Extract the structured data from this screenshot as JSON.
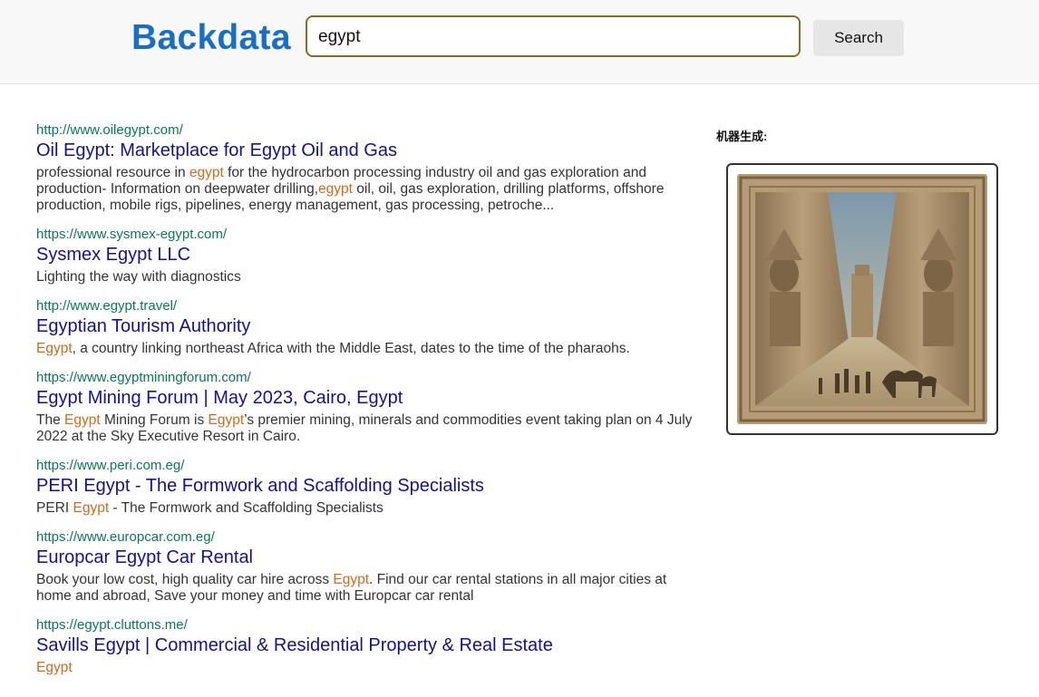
{
  "header": {
    "logo": "Backdata",
    "search_value": "egypt",
    "search_button_label": "Search",
    "brand_color": "#1a6fc4"
  },
  "side_panel": {
    "label": "机器生成:",
    "image_description_icon": "generated-egypt-image"
  },
  "results": [
    {
      "url": "http://www.oilegypt.com/",
      "title": "Oil Egypt: Marketplace for Egypt Oil and Gas",
      "snippet": [
        {
          "t": "professional resource in ",
          "h": false
        },
        {
          "t": "egypt",
          "h": true
        },
        {
          "t": " for the hydrocarbon processing industry oil and gas exploration and production- Information on deepwater drilling,",
          "h": false
        },
        {
          "t": "egypt",
          "h": true
        },
        {
          "t": " oil, oil, gas exploration, drilling platforms, offshore production, mobile rigs, pipelines, energy management, gas processing, petroche...",
          "h": false
        }
      ]
    },
    {
      "url": "https://www.sysmex-egypt.com/",
      "title": "Sysmex Egypt LLC",
      "snippet": [
        {
          "t": "Lighting the way with diagnostics",
          "h": false
        }
      ]
    },
    {
      "url": "http://www.egypt.travel/",
      "title": "Egyptian Tourism Authority",
      "snippet": [
        {
          "t": "Egypt",
          "h": true
        },
        {
          "t": ", a country linking northeast Africa with the Middle East, dates to the time of the pharaohs.",
          "h": false
        }
      ]
    },
    {
      "url": "https://www.egyptminingforum.com/",
      "title": "Egypt Mining Forum | May 2023, Cairo, Egypt",
      "snippet": [
        {
          "t": "The ",
          "h": false
        },
        {
          "t": "Egypt",
          "h": true
        },
        {
          "t": " Mining Forum is ",
          "h": false
        },
        {
          "t": "Egypt",
          "h": true
        },
        {
          "t": "’s premier mining, minerals and commodities event taking plan on 4 July 2022 at the Sky Executive Resort in Cairo.",
          "h": false
        }
      ]
    },
    {
      "url": "https://www.peri.com.eg/",
      "title": "PERI Egypt - The Formwork and Scaffolding Specialists",
      "snippet": [
        {
          "t": "PERI ",
          "h": false
        },
        {
          "t": "Egypt",
          "h": true
        },
        {
          "t": " - The Formwork and Scaffolding Specialists",
          "h": false
        }
      ]
    },
    {
      "url": "https://www.europcar.com.eg/",
      "title": "Europcar Egypt Car Rental",
      "snippet": [
        {
          "t": "Book your low cost, high quality car hire across ",
          "h": false
        },
        {
          "t": "Egypt",
          "h": true
        },
        {
          "t": ". Find our car rental stations in all major cities at home and abroad, Save your money and time with Europcar car rental",
          "h": false
        }
      ]
    },
    {
      "url": "https://egypt.cluttons.me/",
      "title": "Savills Egypt | Commercial & Residential Property & Real Estate",
      "snippet": [
        {
          "t": "Egypt",
          "h": true
        }
      ]
    }
  ]
}
